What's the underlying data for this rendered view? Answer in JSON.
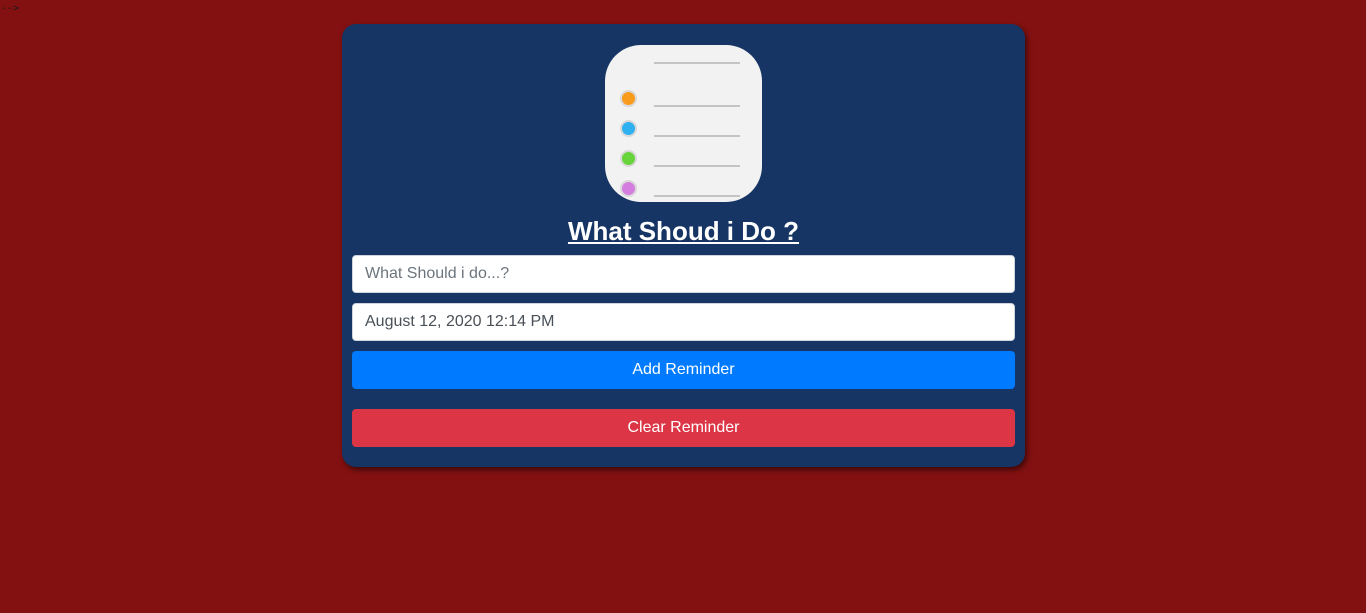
{
  "stray_text": "-->",
  "app": {
    "title": "What Shoud i Do ?",
    "icon_name": "reminders-app-icon",
    "icon_dots": [
      {
        "name": "orange-dot",
        "color": "#f99b1c"
      },
      {
        "name": "blue-dot",
        "color": "#2fb0f0"
      },
      {
        "name": "green-dot",
        "color": "#68d43c"
      },
      {
        "name": "purple-dot",
        "color": "#d47fe0"
      }
    ]
  },
  "form": {
    "task_placeholder": "What Should i do...?",
    "task_value": "",
    "datetime_value": "August 12, 2020 12:14 PM",
    "add_label": "Add Reminder",
    "clear_label": "Clear Reminder"
  },
  "colors": {
    "page_background": "#841111",
    "card_background": "#163564",
    "add_button": "#007bff",
    "clear_button": "#dc3545"
  }
}
